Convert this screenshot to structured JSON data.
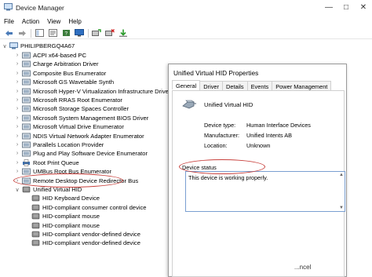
{
  "window": {
    "title": "Device Manager"
  },
  "menu": [
    "File",
    "Action",
    "View",
    "Help"
  ],
  "tree": {
    "root": "PHILIPBERGQ4A67",
    "items": [
      "ACPI x64-based PC",
      "Charge Arbitration Driver",
      "Composite Bus Enumerator",
      "Microsoft GS Wavetable Synth",
      "Microsoft Hyper-V Virtualization Infrastructure Driver",
      "Microsoft RRAS Root Enumerator",
      "Microsoft Storage Spaces Controller",
      "Microsoft System Management BIOS Driver",
      "Microsoft Virtual Drive Enumerator",
      "NDIS Virtual Network Adapter Enumerator",
      "Parallels Location Provider",
      "Plug and Play Software Device Enumerator",
      "Root Print Queue",
      "UMBus Root Bus Enumerator",
      "Remote Desktop Device Redirector Bus",
      "Unified Virtual HID"
    ],
    "children": [
      "HID Keyboard Device",
      "HID-compliant consumer control device",
      "HID-compliant mouse",
      "HID-compliant mouse",
      "HID-compliant vendor-defined device",
      "HID-compliant vendor-defined device"
    ]
  },
  "dialog": {
    "title": "Unified Virtual HID Properties",
    "tabs": [
      "General",
      "Driver",
      "Details",
      "Events",
      "Power Management"
    ],
    "device_name": "Unified Virtual HID",
    "props": [
      {
        "label": "Device type:",
        "value": "Human Interface Devices"
      },
      {
        "label": "Manufacturer:",
        "value": "Unified Intents AB"
      },
      {
        "label": "Location:",
        "value": "Unknown"
      }
    ],
    "status_legend": "Device status",
    "status_text": "This device is working properly.",
    "cancel_fragment": "...ncel"
  },
  "colors": {
    "annotation": "#c8403c",
    "status_border": "#7a9fd1"
  }
}
